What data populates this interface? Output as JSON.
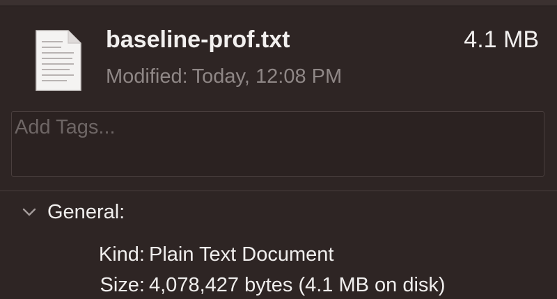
{
  "file": {
    "name": "baseline-prof.txt",
    "size": "4.1 MB",
    "modified_label": "Modified:",
    "modified_value": "Today, 12:08 PM",
    "icon": "text-document-icon"
  },
  "tags": {
    "placeholder": "Add Tags..."
  },
  "general": {
    "title": "General:",
    "expanded_icon": "chevron-down-icon",
    "kind_label": "Kind:",
    "kind_value": "Plain Text Document",
    "size_label": "Size:",
    "size_value": "4,078,427 bytes (4.1 MB on disk)"
  }
}
